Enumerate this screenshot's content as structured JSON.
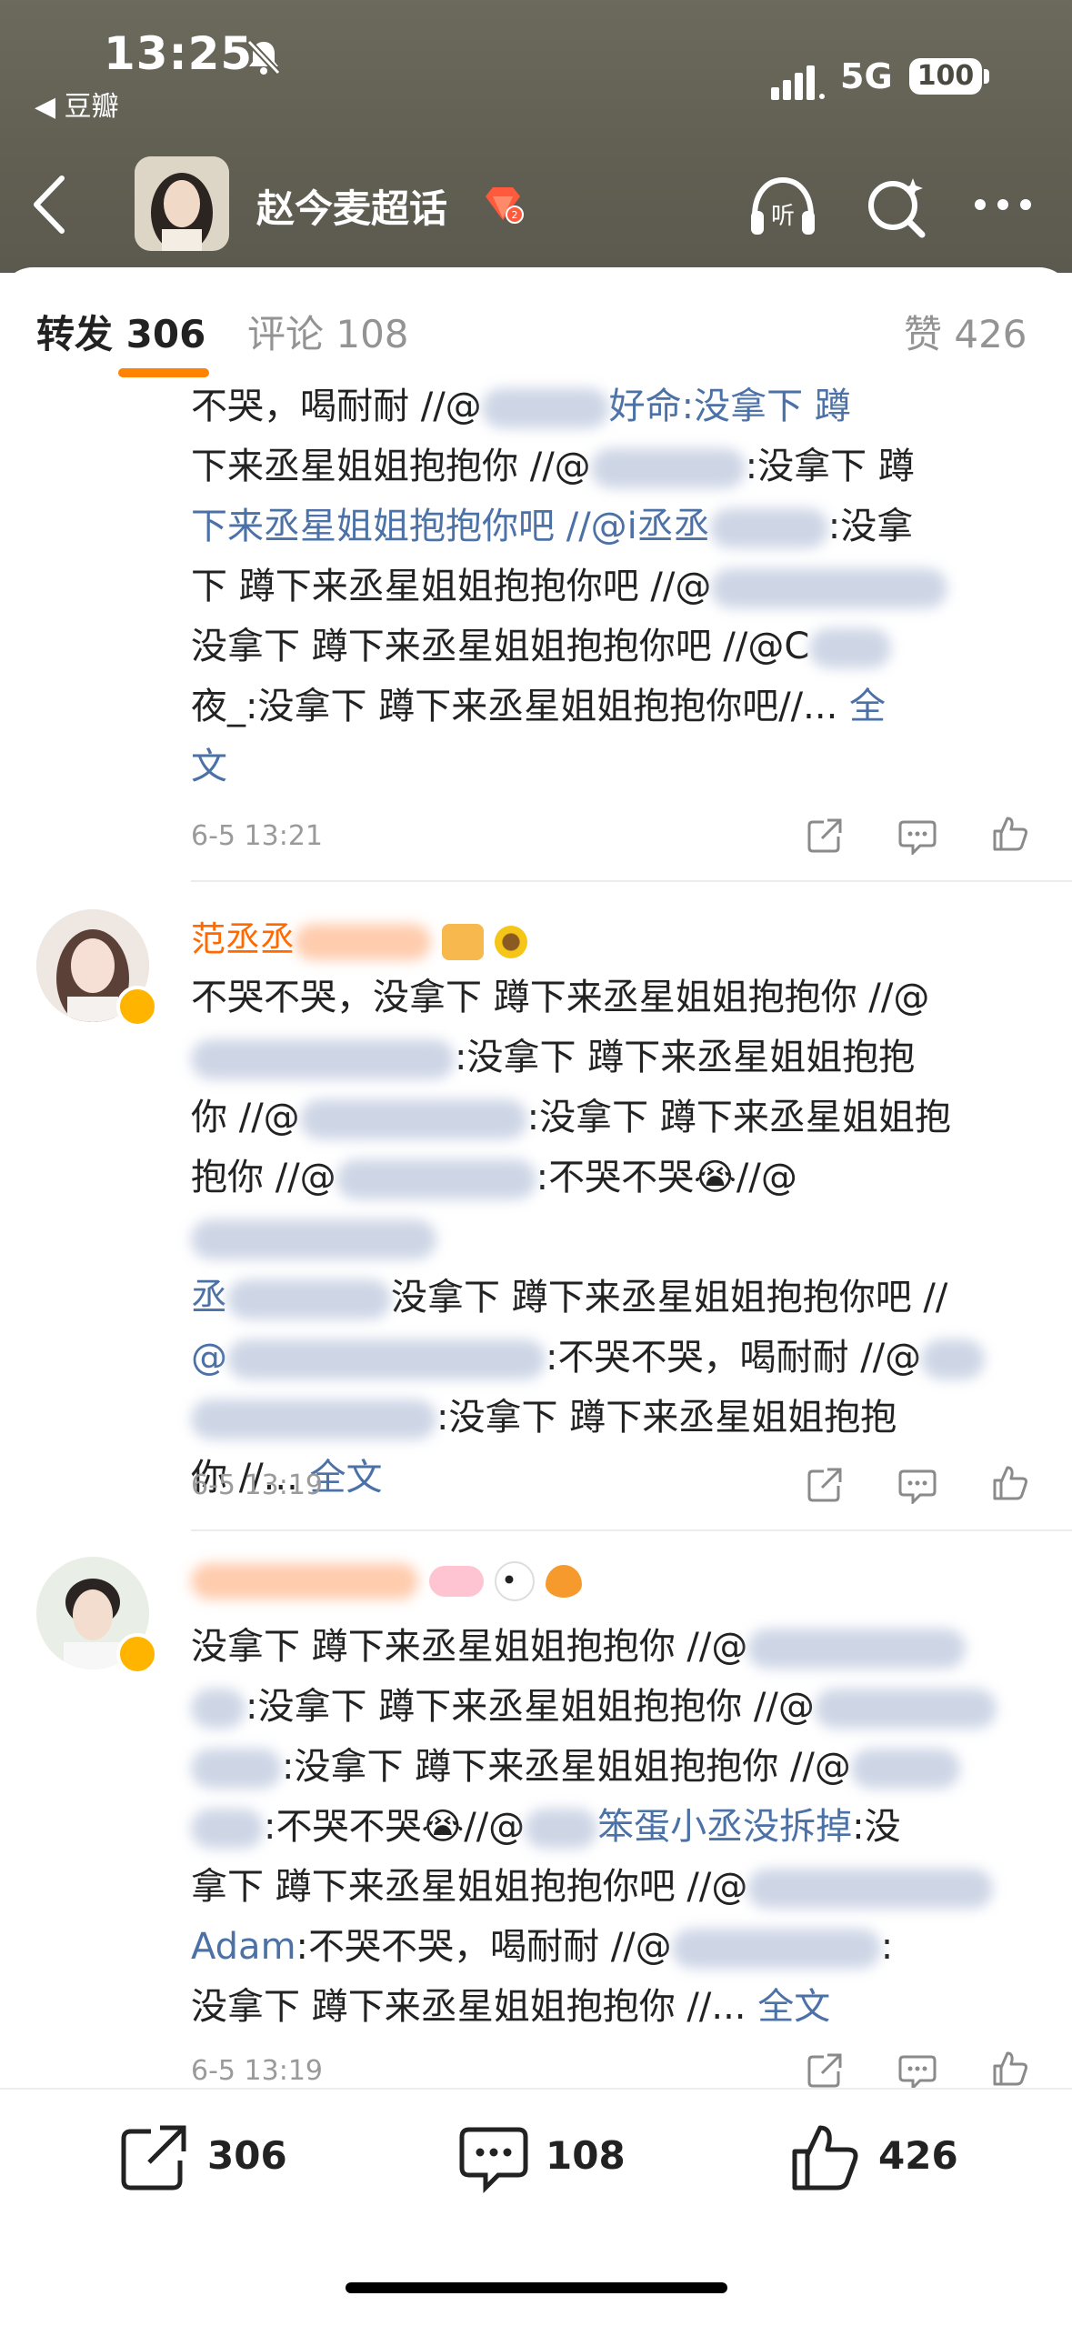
{
  "status_bar": {
    "time": "13:25",
    "back_app": "◀ 豆瓣",
    "network": "5G",
    "battery": "100"
  },
  "nav": {
    "title": "赵今麦超话"
  },
  "tabs": {
    "repost": "转发 306",
    "comment": "评论 108",
    "like": "赞 426"
  },
  "posts": [
    {
      "lines": [
        "不哭，喝耐耐 //@",
        "好命:没拿下 蹲",
        "下来丞星姐姐抱抱你 //@",
        ":没拿下 蹲",
        "下来丞星姐姐抱抱你吧 //@i丞丞",
        ":没拿",
        "下 蹲下来丞星姐姐抱抱你吧 //@",
        "没拿下 蹲下来丞星姐姐抱抱你吧 //@C",
        "夜_:没拿下 蹲下来丞星姐姐抱抱你吧//...",
        "全",
        "文"
      ],
      "time": "6-5 13:21"
    },
    {
      "username": "范丞丞",
      "lines": [
        "不哭不哭，没拿下 蹲下来丞星姐姐抱抱你 //@",
        ":没拿下 蹲下来丞星姐姐抱抱",
        "你 //@",
        ":没拿下 蹲下来丞星姐姐抱",
        "抱你 //@",
        ":不哭不哭😭//@",
        "丞",
        "没拿下 蹲下来丞星姐姐抱抱你吧 //",
        "@",
        ":不哭不哭，喝耐耐 //@",
        ":没拿下 蹲下来丞星姐姐抱抱",
        "你 //...",
        "全文"
      ],
      "time": "6-5 13:19"
    },
    {
      "lines": [
        "没拿下 蹲下来丞星姐姐抱抱你 //@",
        ":没拿下 蹲下来丞星姐姐抱抱你 //@",
        ":没拿下 蹲下来丞星姐姐抱抱你 //@",
        ":不哭不哭😭//@",
        "笨蛋小丞没拆掉",
        ":没",
        "拿下 蹲下来丞星姐姐抱抱你吧 //@",
        "Adam",
        ":不哭不哭，喝耐耐 //@",
        ":",
        "没拿下 蹲下来丞星姐姐抱抱你 //...",
        "全文"
      ],
      "time": "6-5 13:19"
    }
  ],
  "bottom_bar": {
    "repost_count": "306",
    "comment_count": "108",
    "like_count": "426"
  },
  "colors": {
    "accent": "#ff8200",
    "link": "#4b71a6",
    "username": "#ff6a00"
  }
}
